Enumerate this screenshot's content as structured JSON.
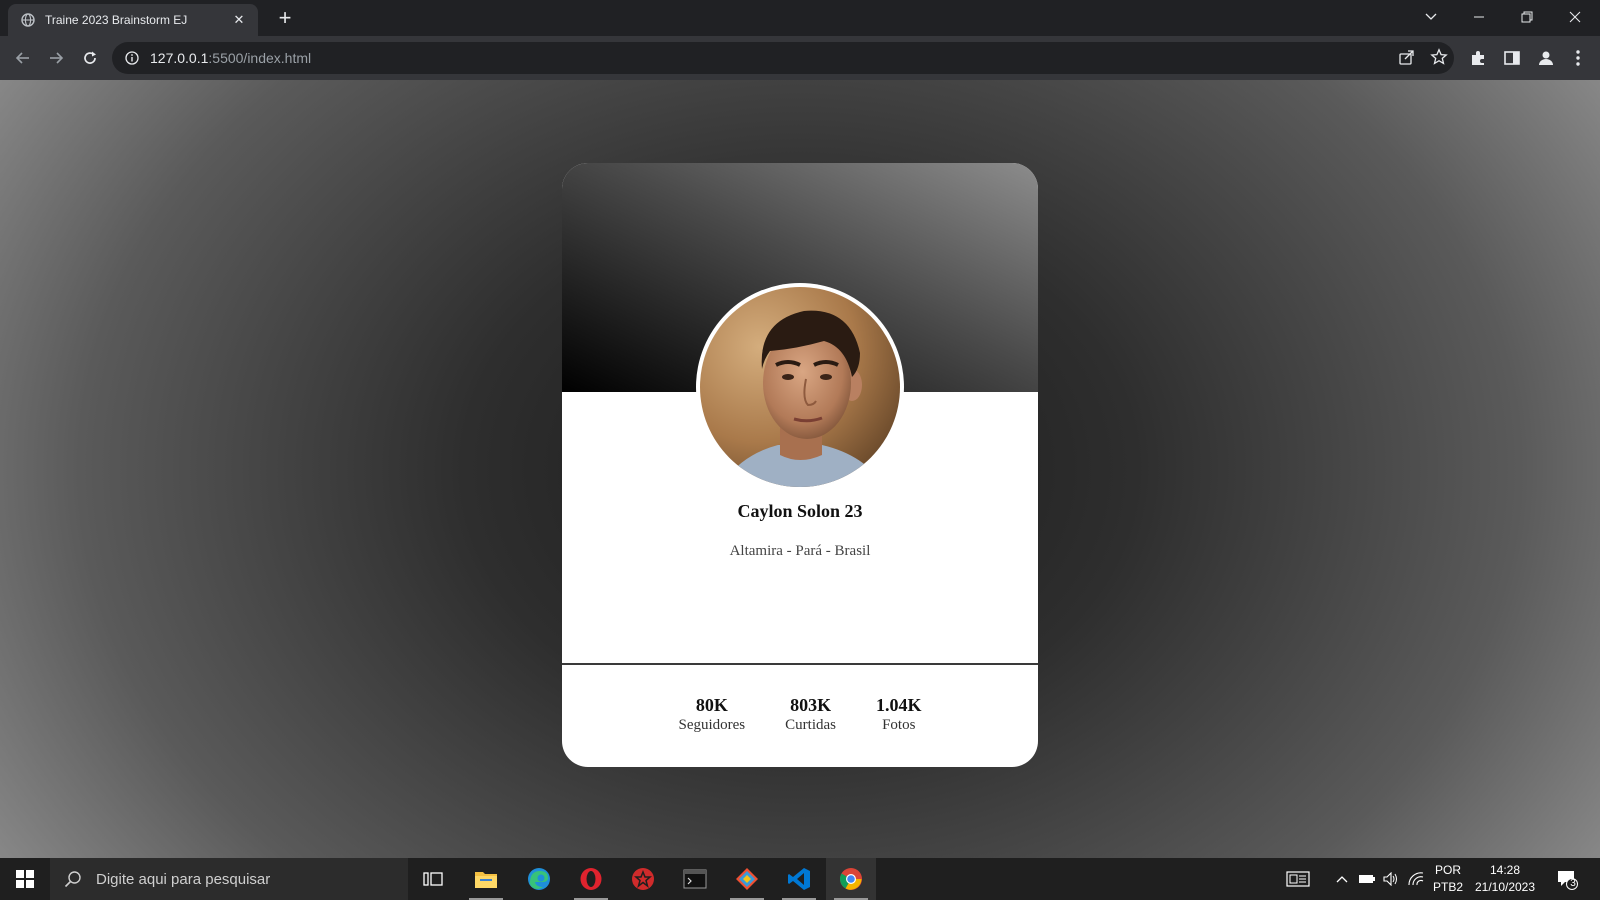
{
  "browser": {
    "tab_title": "Traine 2023 Brainstorm EJ",
    "url_host": "127.0.0.1",
    "url_rest": ":5500/index.html",
    "icons": [
      "globe-icon",
      "close-icon",
      "plus-icon",
      "chevron-down-icon",
      "minimize-icon",
      "restore-icon",
      "window-close-icon",
      "back-icon",
      "forward-icon",
      "reload-icon",
      "info-icon",
      "share-icon",
      "star-icon",
      "extensions-icon",
      "side-panel-icon",
      "profile-icon",
      "menu-icon"
    ]
  },
  "profile": {
    "name": "Caylon Solon 23",
    "location": "Altamira - Pará - Brasil",
    "stats": [
      {
        "value": "80K",
        "label": "Seguidores"
      },
      {
        "value": "803K",
        "label": "Curtidas"
      },
      {
        "value": "1.04K",
        "label": "Fotos"
      }
    ]
  },
  "taskbar": {
    "search_placeholder": "Digite aqui para pesquisar",
    "language": "POR",
    "layout": "PTB2",
    "time": "14:28",
    "date": "21/10/2023",
    "notification_count": "3",
    "apps": [
      "task-view",
      "file-explorer",
      "edge",
      "opera",
      "app-red",
      "terminal",
      "git",
      "vscode",
      "chrome"
    ]
  },
  "colors": {
    "chrome_dark": "#202124",
    "chrome_toolbar": "#35363a",
    "vscode_blue": "#0078d4",
    "opera_red": "#e0232e"
  }
}
